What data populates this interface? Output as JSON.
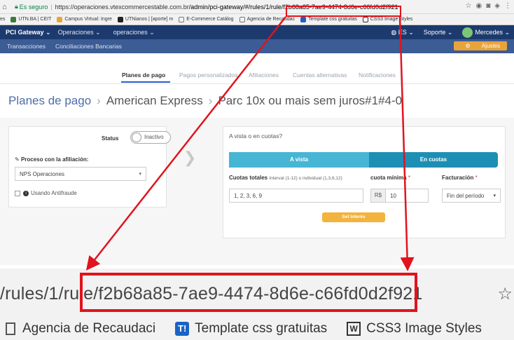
{
  "browser": {
    "security": "Es seguro",
    "url_domain": "https://operaciones.vtexcommercestable.com.br",
    "url_path": "/admin/pci-gateway/#/rules/1/rule/f2b68a85-7ae9-4474-8d6e-c66fd0d2f921",
    "bookmarks": [
      "es",
      "UTN.BA | CEIT",
      "Campus Virtual: Ingre",
      "UTNianos | [aporte] m",
      "E-Commerce Catálog",
      "Agencia de Recaudac",
      "Template css gratuitas",
      "CSS3 Image Styles"
    ]
  },
  "appnav": {
    "brand": "PCI Gateway",
    "menu1": "Operaciones",
    "menu2": "operaciones",
    "lang": "ES",
    "support": "Soporte",
    "user": "Mercedes"
  },
  "subnav": {
    "items": [
      "Transacciones",
      "Conciliaciones Bancarias"
    ],
    "settings": "Ajustes"
  },
  "tabs": [
    "Planes de pago",
    "Pagos personalizados",
    "Afiliaciones",
    "Cuentas alternativas",
    "Notificaciones"
  ],
  "breadcrumb": {
    "root": "Planes de pago",
    "level2": "American Express",
    "level3": "Parc 10x ou mais sem juros#1#4-0"
  },
  "left_card": {
    "status_label": "Status",
    "status_value": "Inactivo",
    "process_label": "Proceso con la afiliación:",
    "process_value": "NPS Operaciones",
    "antifraud_label": "Usando Antifraude"
  },
  "right_card": {
    "title": "A vista o en cuotas?",
    "segment_a": "A vista",
    "segment_b": "En cuotas",
    "cuotas_label": "Cuotas totales",
    "cuotas_hint": "Interval (1-12) o individual (1,3,6,12)",
    "cuotas_value": "1, 2, 3, 6, 9",
    "min_label": "cuota mínima",
    "min_req": "*",
    "currency": "R$",
    "min_value": "10",
    "billing_label": "Facturación",
    "billing_req": "*",
    "billing_value": "Fin del período",
    "button": "Set Interés"
  },
  "zoom": {
    "url_text": "/rules/1/rule/f2b68a85-7ae9-4474-8d6e-c66fd0d2f921",
    "bookmarks": [
      "Agencia de Recaudaci",
      "Template css gratuitas",
      "CSS3 Image Styles"
    ],
    "bm_t": "T!",
    "bm_w": "W"
  },
  "colors": {
    "highlight": "#e1131d",
    "nav": "#1c3a6e",
    "subnav": "#3b5c94",
    "accent_button": "#f3b33d"
  }
}
